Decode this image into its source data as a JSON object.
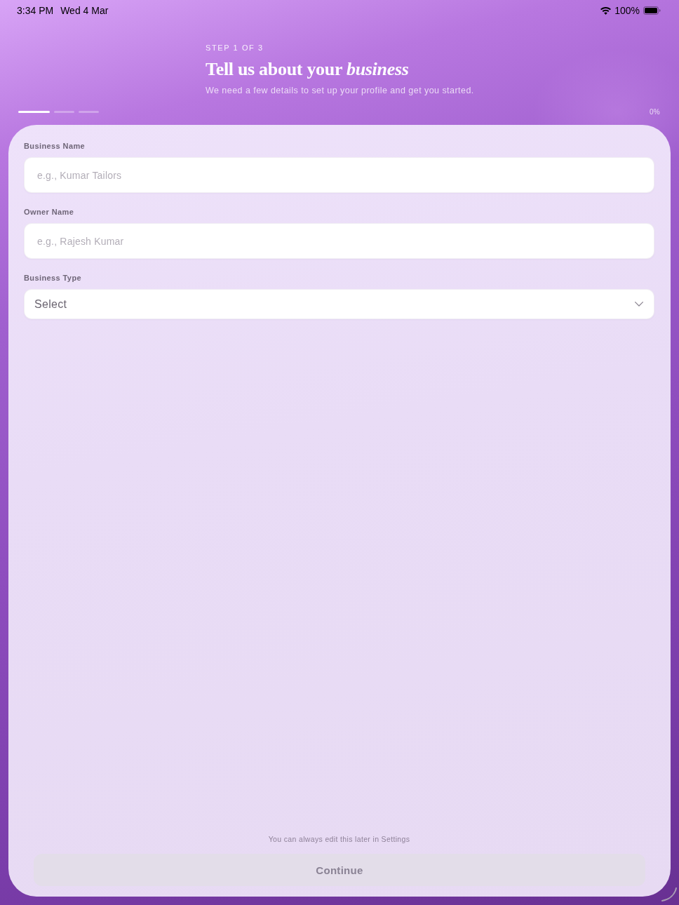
{
  "status_bar": {
    "time": "3:34 PM",
    "date": "Wed 4 Mar",
    "battery": "100%"
  },
  "header": {
    "step": "STEP 1 OF 3",
    "title": "Tell us about your *business*",
    "subtitle": "We need a few details to set up your profile and get you started."
  },
  "progress": {
    "segments": [
      {
        "active": true
      },
      {
        "active": false
      },
      {
        "active": false
      }
    ],
    "percent": "0%"
  },
  "form": {
    "fields": [
      {
        "kind": "text",
        "label": "Business Name",
        "placeholder": "e.g., Kumar Tailors"
      },
      {
        "kind": "text",
        "label": "Owner Name",
        "placeholder": "e.g., Rajesh Kumar"
      },
      {
        "kind": "select",
        "label": "Business Type",
        "placeholder": "Select"
      }
    ]
  },
  "footer": {
    "note": "You can always edit this later in Settings",
    "button": {
      "label": "Continue",
      "disabled": true
    }
  }
}
